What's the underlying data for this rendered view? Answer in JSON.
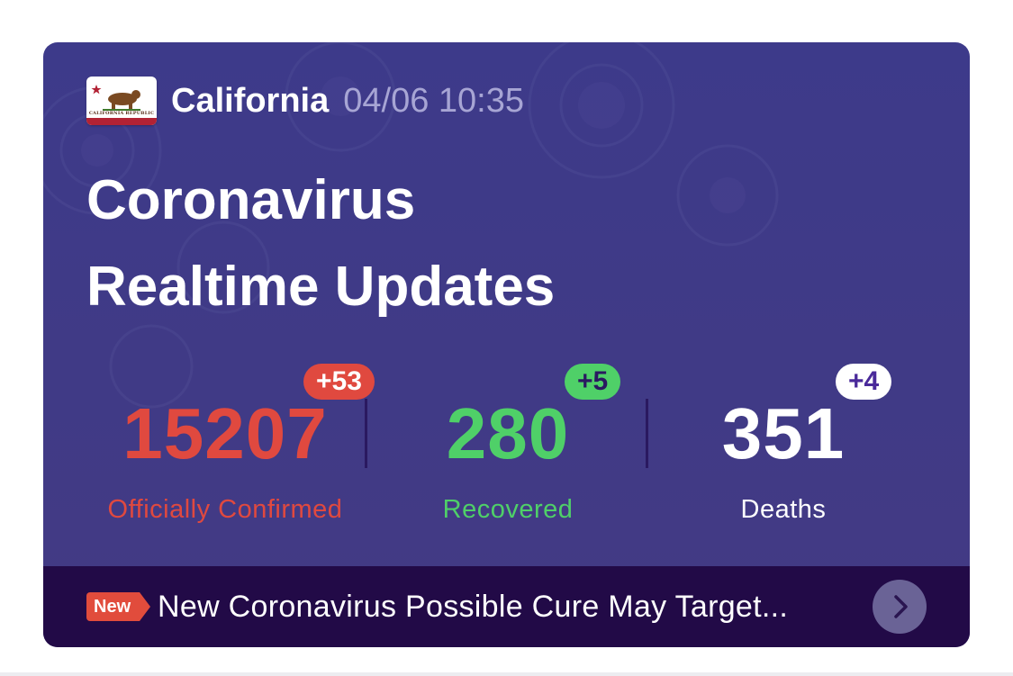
{
  "header": {
    "flag_icon": "california-flag-icon",
    "flag_caption": "CALIFORNIA REPUBLIC",
    "region": "California",
    "timestamp": "04/06 10:35"
  },
  "title": {
    "line1": "Coronavirus",
    "line2": "Realtime Updates"
  },
  "stats": {
    "confirmed": {
      "value": "15207",
      "delta": "+53",
      "label": "Officially Confirmed",
      "color": "#e0493f"
    },
    "recovered": {
      "value": "280",
      "delta": "+5",
      "label": "Recovered",
      "color": "#4fd068"
    },
    "deaths": {
      "value": "351",
      "delta": "+4",
      "label": "Deaths",
      "color": "#ffffff"
    }
  },
  "news": {
    "tag": "New",
    "headline": "New Coronavirus Possible Cure May Target...",
    "arrow_icon": "chevron-right-icon"
  },
  "colors": {
    "card_background": "#3f3a88",
    "news_bar": "#220a47",
    "badge_confirmed": "#e0493f",
    "badge_recovered": "#4fd068",
    "badge_deaths": "#ffffff"
  }
}
